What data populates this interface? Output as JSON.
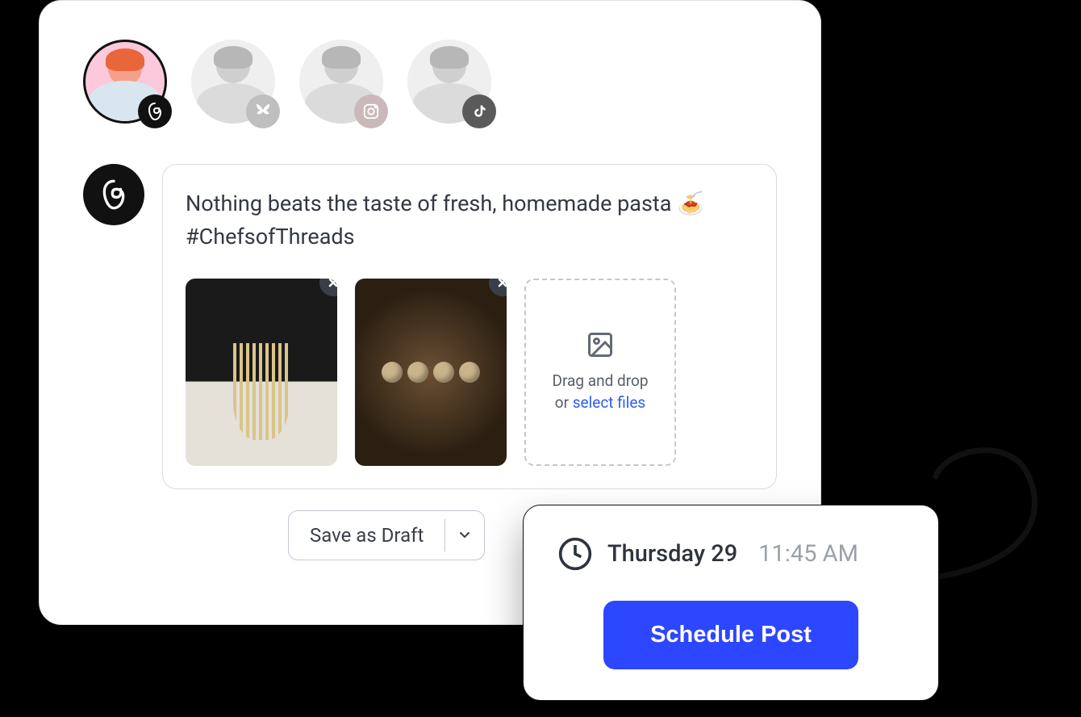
{
  "accounts": [
    {
      "network": "threads",
      "label": "Threads",
      "active": true
    },
    {
      "network": "bluesky",
      "label": "Bluesky",
      "active": false
    },
    {
      "network": "instagram",
      "label": "Instagram",
      "active": false
    },
    {
      "network": "tiktok",
      "label": "TikTok",
      "active": false
    }
  ],
  "compose": {
    "network_icon": "threads",
    "text": "Nothing beats the taste of fresh, homemade pasta 🍝 #ChefsofThreads",
    "media": [
      {
        "alt": "fresh pasta being made"
      },
      {
        "alt": "pasta dumplings on board"
      }
    ],
    "dropzone": {
      "line1": "Drag and drop",
      "line2_prefix": "or ",
      "line2_link": "select files"
    }
  },
  "actions": {
    "save_draft": "Save as Draft"
  },
  "schedule": {
    "date": "Thursday 29",
    "time": "11:45 AM",
    "button": "Schedule Post"
  }
}
